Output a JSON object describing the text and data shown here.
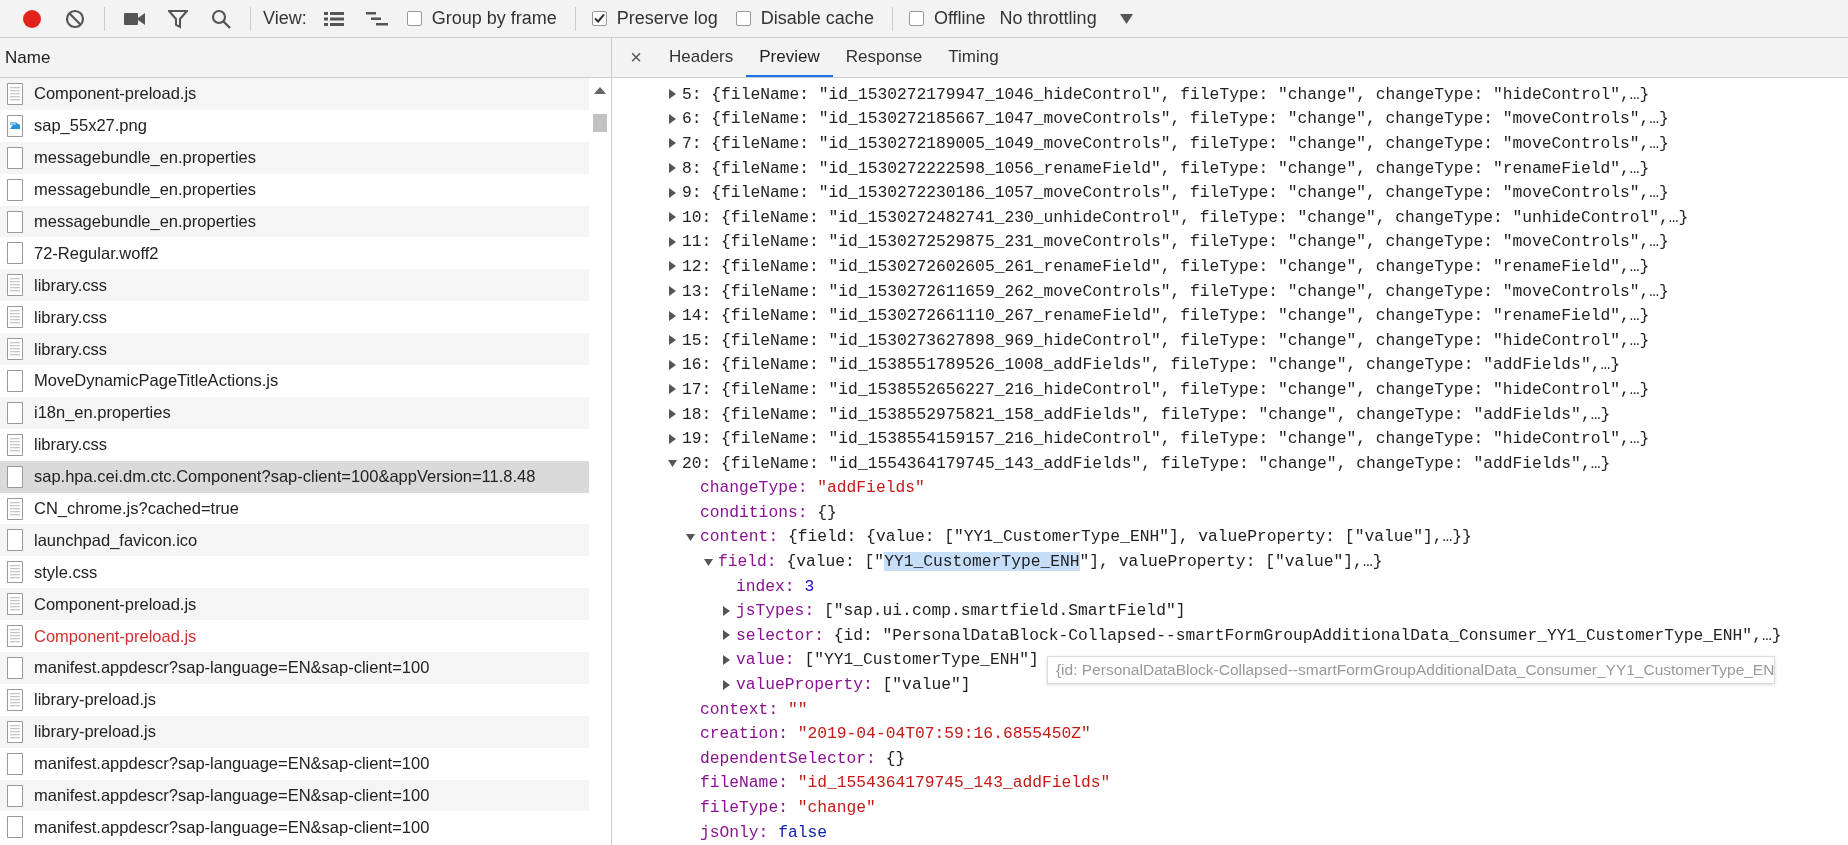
{
  "toolbar": {
    "recording": true,
    "view_label": "View:",
    "options": [
      {
        "label": "Group by frame",
        "checked": false
      },
      {
        "label": "Preserve log",
        "checked": true
      },
      {
        "label": "Disable cache",
        "checked": false
      },
      {
        "label": "Offline",
        "checked": false
      }
    ],
    "throttling": "No throttling"
  },
  "requests": {
    "column": "Name",
    "rows": [
      {
        "name": "Component-preload.js",
        "kind": "doc",
        "selected": false,
        "failed": false
      },
      {
        "name": "sap_55x27.png",
        "kind": "image",
        "selected": false,
        "failed": false
      },
      {
        "name": "messagebundle_en.properties",
        "kind": "blank",
        "selected": false,
        "failed": false
      },
      {
        "name": "messagebundle_en.properties",
        "kind": "blank",
        "selected": false,
        "failed": false
      },
      {
        "name": "messagebundle_en.properties",
        "kind": "blank",
        "selected": false,
        "failed": false
      },
      {
        "name": "72-Regular.woff2",
        "kind": "blank",
        "selected": false,
        "failed": false
      },
      {
        "name": "library.css",
        "kind": "doc",
        "selected": false,
        "failed": false
      },
      {
        "name": "library.css",
        "kind": "doc",
        "selected": false,
        "failed": false
      },
      {
        "name": "library.css",
        "kind": "doc",
        "selected": false,
        "failed": false
      },
      {
        "name": "MoveDynamicPageTitleActions.js",
        "kind": "blank",
        "selected": false,
        "failed": false
      },
      {
        "name": "i18n_en.properties",
        "kind": "blank",
        "selected": false,
        "failed": false
      },
      {
        "name": "library.css",
        "kind": "doc",
        "selected": false,
        "failed": false
      },
      {
        "name": "sap.hpa.cei.dm.ctc.Component?sap-client=100&appVersion=11.8.48",
        "kind": "blank",
        "selected": true,
        "failed": false
      },
      {
        "name": "CN_chrome.js?cached=true",
        "kind": "doc",
        "selected": false,
        "failed": false
      },
      {
        "name": "launchpad_favicon.ico",
        "kind": "blank",
        "selected": false,
        "failed": false
      },
      {
        "name": "style.css",
        "kind": "doc",
        "selected": false,
        "failed": false
      },
      {
        "name": "Component-preload.js",
        "kind": "doc",
        "selected": false,
        "failed": false
      },
      {
        "name": "Component-preload.js",
        "kind": "doc",
        "selected": false,
        "failed": true
      },
      {
        "name": "manifest.appdescr?sap-language=EN&sap-client=100",
        "kind": "blank",
        "selected": false,
        "failed": false
      },
      {
        "name": "library-preload.js",
        "kind": "doc",
        "selected": false,
        "failed": false
      },
      {
        "name": "library-preload.js",
        "kind": "doc",
        "selected": false,
        "failed": false
      },
      {
        "name": "manifest.appdescr?sap-language=EN&sap-client=100",
        "kind": "blank",
        "selected": false,
        "failed": false
      },
      {
        "name": "manifest.appdescr?sap-language=EN&sap-client=100",
        "kind": "blank",
        "selected": false,
        "failed": false
      },
      {
        "name": "manifest.appdescr?sap-language=EN&sap-client=100",
        "kind": "blank",
        "selected": false,
        "failed": false
      }
    ]
  },
  "detail": {
    "close": "×",
    "tabs": [
      {
        "label": "Headers",
        "selected": false
      },
      {
        "label": "Preview",
        "selected": true
      },
      {
        "label": "Response",
        "selected": false
      },
      {
        "label": "Timing",
        "selected": false
      }
    ],
    "preview": [
      {
        "kind": "object",
        "key": "5:",
        "expanded": false,
        "summary": "{fileName: \"id_1530272179947_1046_hideControl\", fileType: \"change\", changeType: \"hideControl\",…}"
      },
      {
        "kind": "object",
        "key": "6:",
        "expanded": false,
        "summary": "{fileName: \"id_1530272185667_1047_moveControls\", fileType: \"change\", changeType: \"moveControls\",…}"
      },
      {
        "kind": "object",
        "key": "7:",
        "expanded": false,
        "summary": "{fileName: \"id_1530272189005_1049_moveControls\", fileType: \"change\", changeType: \"moveControls\",…}"
      },
      {
        "kind": "object",
        "key": "8:",
        "expanded": false,
        "summary": "{fileName: \"id_1530272222598_1056_renameField\", fileType: \"change\", changeType: \"renameField\",…}"
      },
      {
        "kind": "object",
        "key": "9:",
        "expanded": false,
        "summary": "{fileName: \"id_1530272230186_1057_moveControls\", fileType: \"change\", changeType: \"moveControls\",…}"
      },
      {
        "kind": "object",
        "key": "10:",
        "expanded": false,
        "summary": "{fileName: \"id_1530272482741_230_unhideControl\", fileType: \"change\", changeType: \"unhideControl\",…}"
      },
      {
        "kind": "object",
        "key": "11:",
        "expanded": false,
        "summary": "{fileName: \"id_1530272529875_231_moveControls\", fileType: \"change\", changeType: \"moveControls\",…}"
      },
      {
        "kind": "object",
        "key": "12:",
        "expanded": false,
        "summary": "{fileName: \"id_1530272602605_261_renameField\", fileType: \"change\", changeType: \"renameField\",…}"
      },
      {
        "kind": "object",
        "key": "13:",
        "expanded": false,
        "summary": "{fileName: \"id_1530272611659_262_moveControls\", fileType: \"change\", changeType: \"moveControls\",…}"
      },
      {
        "kind": "object",
        "key": "14:",
        "expanded": false,
        "summary": "{fileName: \"id_1530272661110_267_renameField\", fileType: \"change\", changeType: \"renameField\",…}"
      },
      {
        "kind": "object",
        "key": "15:",
        "expanded": false,
        "summary": "{fileName: \"id_1530273627898_969_hideControl\", fileType: \"change\", changeType: \"hideControl\",…}"
      },
      {
        "kind": "object",
        "key": "16:",
        "expanded": false,
        "summary": "{fileName: \"id_1538551789526_1008_addFields\", fileType: \"change\", changeType: \"addFields\",…}"
      },
      {
        "kind": "object",
        "key": "17:",
        "expanded": false,
        "summary": "{fileName: \"id_1538552656227_216_hideControl\", fileType: \"change\", changeType: \"hideControl\",…}"
      },
      {
        "kind": "object",
        "key": "18:",
        "expanded": false,
        "summary": "{fileName: \"id_1538552975821_158_addFields\", fileType: \"change\", changeType: \"addFields\",…}"
      },
      {
        "kind": "object",
        "key": "19:",
        "expanded": false,
        "summary": "{fileName: \"id_1538554159157_216_hideControl\", fileType: \"change\", changeType: \"hideControl\",…}"
      },
      {
        "kind": "object",
        "key": "20:",
        "expanded": true,
        "summary": "{fileName: \"id_1554364179745_143_addFields\", fileType: \"change\", changeType: \"addFields\",…}",
        "children": [
          {
            "kind": "value",
            "key": "changeType:",
            "value": "\"addFields\"",
            "color": "#c41a16"
          },
          {
            "kind": "value",
            "key": "conditions:",
            "value": "{}",
            "color": "#222222"
          },
          {
            "kind": "object",
            "key": "content:",
            "expanded": true,
            "summary": "{field: {value: [\"YY1_CustomerType_ENH\"], valueProperty: [\"value\"],…}}",
            "children": [
              {
                "kind": "object",
                "key": "field:",
                "expanded": true,
                "summary": [
                  {
                    "text": "{value: [\"",
                    "highlighted": false
                  },
                  {
                    "text": "YY1_CustomerType_ENH",
                    "highlighted": true
                  },
                  {
                    "text": "\"], valueProperty: [\"value\"],…}",
                    "highlighted": false
                  }
                ],
                "children": [
                  {
                    "kind": "value",
                    "key": "index:",
                    "value": "3",
                    "color": "#1c00cf"
                  },
                  {
                    "kind": "object",
                    "key": "jsTypes:",
                    "expanded": false,
                    "summary": "[\"sap.ui.comp.smartfield.SmartField\"]"
                  },
                  {
                    "kind": "object",
                    "key": "selector:",
                    "expanded": false,
                    "summary": "{id: \"PersonalDataBlock-Collapsed--smartFormGroupAdditionalData_Consumer_YY1_CustomerType_ENH\",…}"
                  },
                  {
                    "kind": "object",
                    "key": "value:",
                    "expanded": false,
                    "summary": "[\"YY1_CustomerType_ENH\"]",
                    "tooltip": "{id: PersonalDataBlock-Collapsed--smartFormGroupAdditionalData_Consumer_YY1_CustomerType_EN"
                  },
                  {
                    "kind": "object",
                    "key": "valueProperty:",
                    "expanded": false,
                    "summary": "[\"value\"]"
                  }
                ]
              }
            ]
          },
          {
            "kind": "value",
            "key": "context:",
            "value": "\"\"",
            "color": "#c41a16"
          },
          {
            "kind": "value",
            "key": "creation:",
            "value": "\"2019-04-04T07:59:16.6855450Z\"",
            "color": "#c41a16"
          },
          {
            "kind": "value",
            "key": "dependentSelector:",
            "value": "{}",
            "color": "#222222"
          },
          {
            "kind": "value",
            "key": "fileName:",
            "value": "\"id_1554364179745_143_addFields\"",
            "color": "#c41a16"
          },
          {
            "kind": "value",
            "key": "fileType:",
            "value": "\"change\"",
            "color": "#c41a16"
          },
          {
            "kind": "value",
            "key": "jsOnly:",
            "value": "false",
            "color": "#0d22aa"
          }
        ]
      }
    ]
  }
}
